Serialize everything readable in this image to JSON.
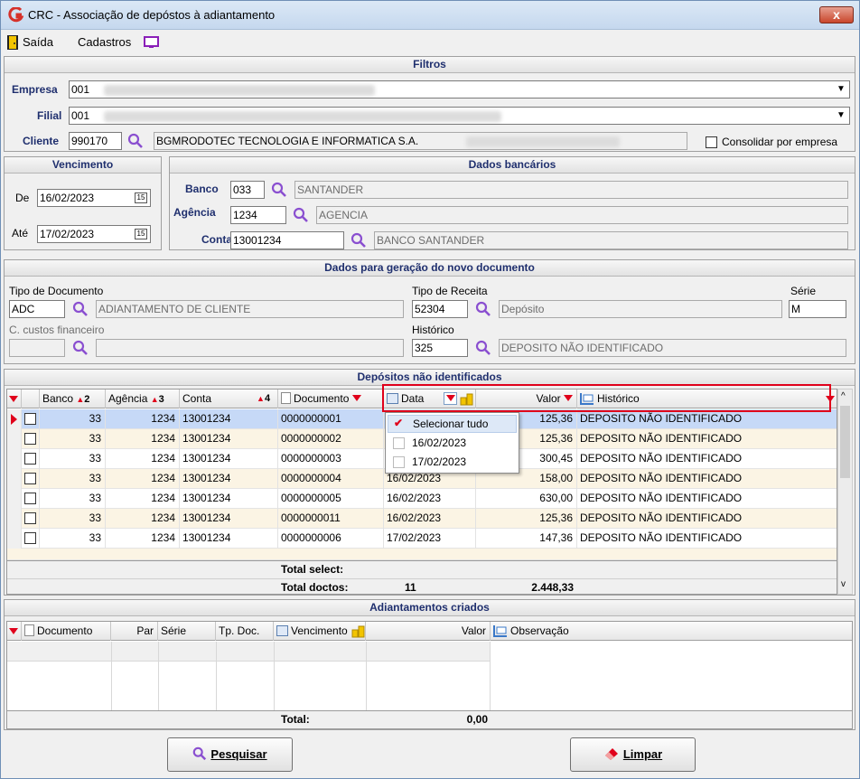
{
  "window": {
    "title": "CRC - Associação de depóstos à adiantamento",
    "close_glyph": "x"
  },
  "menu": {
    "saida": "Saída",
    "cadastros": "Cadastros"
  },
  "filtros": {
    "title": "Filtros",
    "empresa_label": "Empresa",
    "empresa_value": "001",
    "filial_label": "Filial",
    "filial_value": "001",
    "cliente_label": "Cliente",
    "cliente_code": "990170",
    "cliente_name": "BGMRODOTEC TECNOLOGIA E INFORMATICA S.A.",
    "consolidar_label": "Consolidar por empresa"
  },
  "vencimento": {
    "title": "Vencimento",
    "de_label": "De",
    "de_value": "16/02/2023",
    "ate_label": "Até",
    "ate_value": "17/02/2023",
    "cal_glyph": "15"
  },
  "dados_bancarios": {
    "title": "Dados bancários",
    "banco_label": "Banco",
    "banco_code": "033",
    "banco_name": "SANTANDER",
    "agencia_label": "Agência",
    "agencia_code": "1234",
    "agencia_name": "AGENCIA",
    "conta_label": "Conta",
    "conta_code": "13001234",
    "conta_name": "BANCO SANTANDER"
  },
  "novo_documento": {
    "title": "Dados para geração do novo documento",
    "tipo_doc_label": "Tipo de Documento",
    "tipo_doc_code": "ADC",
    "tipo_doc_name": "ADIANTAMENTO DE CLIENTE",
    "tipo_receita_label": "Tipo de Receita",
    "tipo_receita_code": "52304",
    "tipo_receita_name": "Depósito",
    "serie_label": "Série",
    "serie_value": "M",
    "ccustos_label": "C. custos financeiro",
    "historico_label": "Histórico",
    "historico_code": "325",
    "historico_name": "DEPOSITO NÃO IDENTIFICADO"
  },
  "depositos": {
    "title": "Depósitos não identificados",
    "headers": {
      "banco": "Banco",
      "banco_sort": "2",
      "agencia": "Agência",
      "agencia_sort": "3",
      "conta": "Conta",
      "conta_sort": "4",
      "documento": "Documento",
      "data": "Data",
      "valor": "Valor",
      "historico": "Histórico"
    },
    "rows": [
      {
        "banco": "33",
        "agencia": "1234",
        "conta": "13001234",
        "documento": "0000000001",
        "data": "",
        "valor": "125,36",
        "historico": "DEPOSITO NÃO IDENTIFICADO"
      },
      {
        "banco": "33",
        "agencia": "1234",
        "conta": "13001234",
        "documento": "0000000002",
        "data": "",
        "valor": "125,36",
        "historico": "DEPOSITO NÃO IDENTIFICADO"
      },
      {
        "banco": "33",
        "agencia": "1234",
        "conta": "13001234",
        "documento": "0000000003",
        "data": "",
        "valor": "300,45",
        "historico": "DEPOSITO NÃO IDENTIFICADO"
      },
      {
        "banco": "33",
        "agencia": "1234",
        "conta": "13001234",
        "documento": "0000000004",
        "data": "16/02/2023",
        "valor": "158,00",
        "historico": "DEPOSITO NÃO IDENTIFICADO"
      },
      {
        "banco": "33",
        "agencia": "1234",
        "conta": "13001234",
        "documento": "0000000005",
        "data": "16/02/2023",
        "valor": "630,00",
        "historico": "DEPOSITO NÃO IDENTIFICADO"
      },
      {
        "banco": "33",
        "agencia": "1234",
        "conta": "13001234",
        "documento": "0000000011",
        "data": "16/02/2023",
        "valor": "125,36",
        "historico": "DEPOSITO NÃO IDENTIFICADO"
      },
      {
        "banco": "33",
        "agencia": "1234",
        "conta": "13001234",
        "documento": "0000000006",
        "data": "17/02/2023",
        "valor": "147,36",
        "historico": "DEPOSITO NÃO IDENTIFICADO"
      }
    ],
    "filter_popup": {
      "select_all": "Selecionar tudo",
      "opt1": "16/02/2023",
      "opt2": "17/02/2023"
    },
    "total_select_label": "Total select:",
    "total_doctos_label": "Total doctos:",
    "total_doctos_count": "11",
    "total_doctos_value": "2.448,33"
  },
  "adiantamentos": {
    "title": "Adiantamentos criados",
    "headers": {
      "documento": "Documento",
      "par": "Par",
      "serie": "Série",
      "tp_doc": "Tp. Doc.",
      "vencimento": "Vencimento",
      "valor": "Valor",
      "observacao": "Observação"
    },
    "total_label": "Total:",
    "total_value": "0,00"
  },
  "buttons": {
    "pesquisar": "Pesquisar",
    "limpar": "Limpar"
  },
  "colors": {
    "accent": "#1f2f6e",
    "highlight_row": "#c6d9f7",
    "alt_row": "#fbf4e4",
    "filter_border": "#e0001b"
  }
}
